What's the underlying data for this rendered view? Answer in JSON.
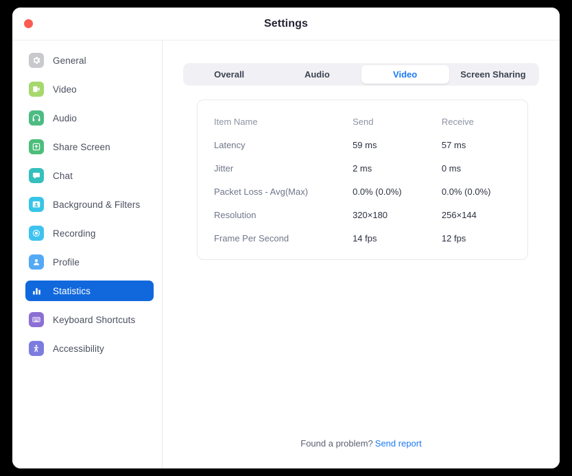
{
  "window": {
    "title": "Settings",
    "close_button": "close-button"
  },
  "sidebar": {
    "items": [
      {
        "label": "General",
        "icon": "gear-icon",
        "color": "#c8c9cc",
        "selected": false
      },
      {
        "label": "Video",
        "icon": "video-icon",
        "color": "#a6d86e",
        "selected": false
      },
      {
        "label": "Audio",
        "icon": "headphones-icon",
        "color": "#4cbc82",
        "selected": false
      },
      {
        "label": "Share Screen",
        "icon": "share-screen-icon",
        "color": "#4cbe7a",
        "selected": false
      },
      {
        "label": "Chat",
        "icon": "chat-icon",
        "color": "#35bfbd",
        "selected": false
      },
      {
        "label": "Background & Filters",
        "icon": "background-icon",
        "color": "#36c5e8",
        "selected": false
      },
      {
        "label": "Recording",
        "icon": "recording-icon",
        "color": "#3ec3f0",
        "selected": false
      },
      {
        "label": "Profile",
        "icon": "profile-icon",
        "color": "#54a9f5",
        "selected": false
      },
      {
        "label": "Statistics",
        "icon": "statistics-icon",
        "color": "#1168dd",
        "selected": true
      },
      {
        "label": "Keyboard Shortcuts",
        "icon": "keyboard-icon",
        "color": "#8c6fd4",
        "selected": false
      },
      {
        "label": "Accessibility",
        "icon": "accessibility-icon",
        "color": "#7c7ce0",
        "selected": false
      }
    ]
  },
  "tabs": [
    {
      "label": "Overall",
      "active": false
    },
    {
      "label": "Audio",
      "active": false
    },
    {
      "label": "Video",
      "active": true
    },
    {
      "label": "Screen Sharing",
      "active": false
    }
  ],
  "stats_table": {
    "headers": [
      "Item Name",
      "Send",
      "Receive"
    ],
    "rows": [
      {
        "item": "Latency",
        "send": "59 ms",
        "receive": "57 ms"
      },
      {
        "item": "Jitter",
        "send": "2 ms",
        "receive": "0 ms"
      },
      {
        "item": "Packet Loss - Avg(Max)",
        "send": "0.0% (0.0%)",
        "receive": "0.0% (0.0%)"
      },
      {
        "item": "Resolution",
        "send": "320×180",
        "receive": "256×144"
      },
      {
        "item": "Frame Per Second",
        "send": "14 fps",
        "receive": "12 fps"
      }
    ]
  },
  "footer": {
    "text": "Found a problem?",
    "link": "Send report"
  },
  "colors": {
    "accent": "#1b7af5",
    "selected_nav": "#1168dd",
    "close": "#fc5b52"
  }
}
